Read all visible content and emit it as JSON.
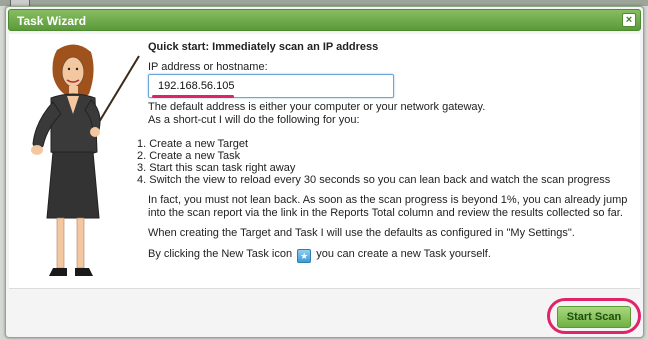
{
  "dialog": {
    "title": "Task Wizard",
    "close_glyph": "×",
    "heading": "Quick start: Immediately scan an IP address",
    "ip_label": "IP address or hostname:",
    "ip_value": "192.168.56.105",
    "default_note": "The default address is either your computer or your network gateway.",
    "shortcut_note": "As a short-cut I will do the following for you:",
    "steps": [
      "Create a new Target",
      "Create a new Task",
      "Start this scan task right away",
      "Switch the view to reload every 30 seconds so you can lean back and watch the scan progress"
    ],
    "para_progress": "In fact, you must not lean back. As soon as the scan progress is beyond 1%, you can already jump into the scan report via the link in the Reports Total column and review the results collected so far.",
    "para_defaults": "When creating the Target and Task I will use the defaults as configured in \"My Settings\".",
    "para_newtask_before": "By clicking the New Task icon",
    "para_newtask_after": "you can create a new Task yourself.",
    "start_button": "Start Scan"
  },
  "icons": {
    "close": "close-icon",
    "new_task": "new-task-icon",
    "figure": "wizard-figure"
  },
  "colors": {
    "titlebar": "#5b9a3a",
    "button": "#6fb142",
    "highlight": "#e0246a"
  }
}
